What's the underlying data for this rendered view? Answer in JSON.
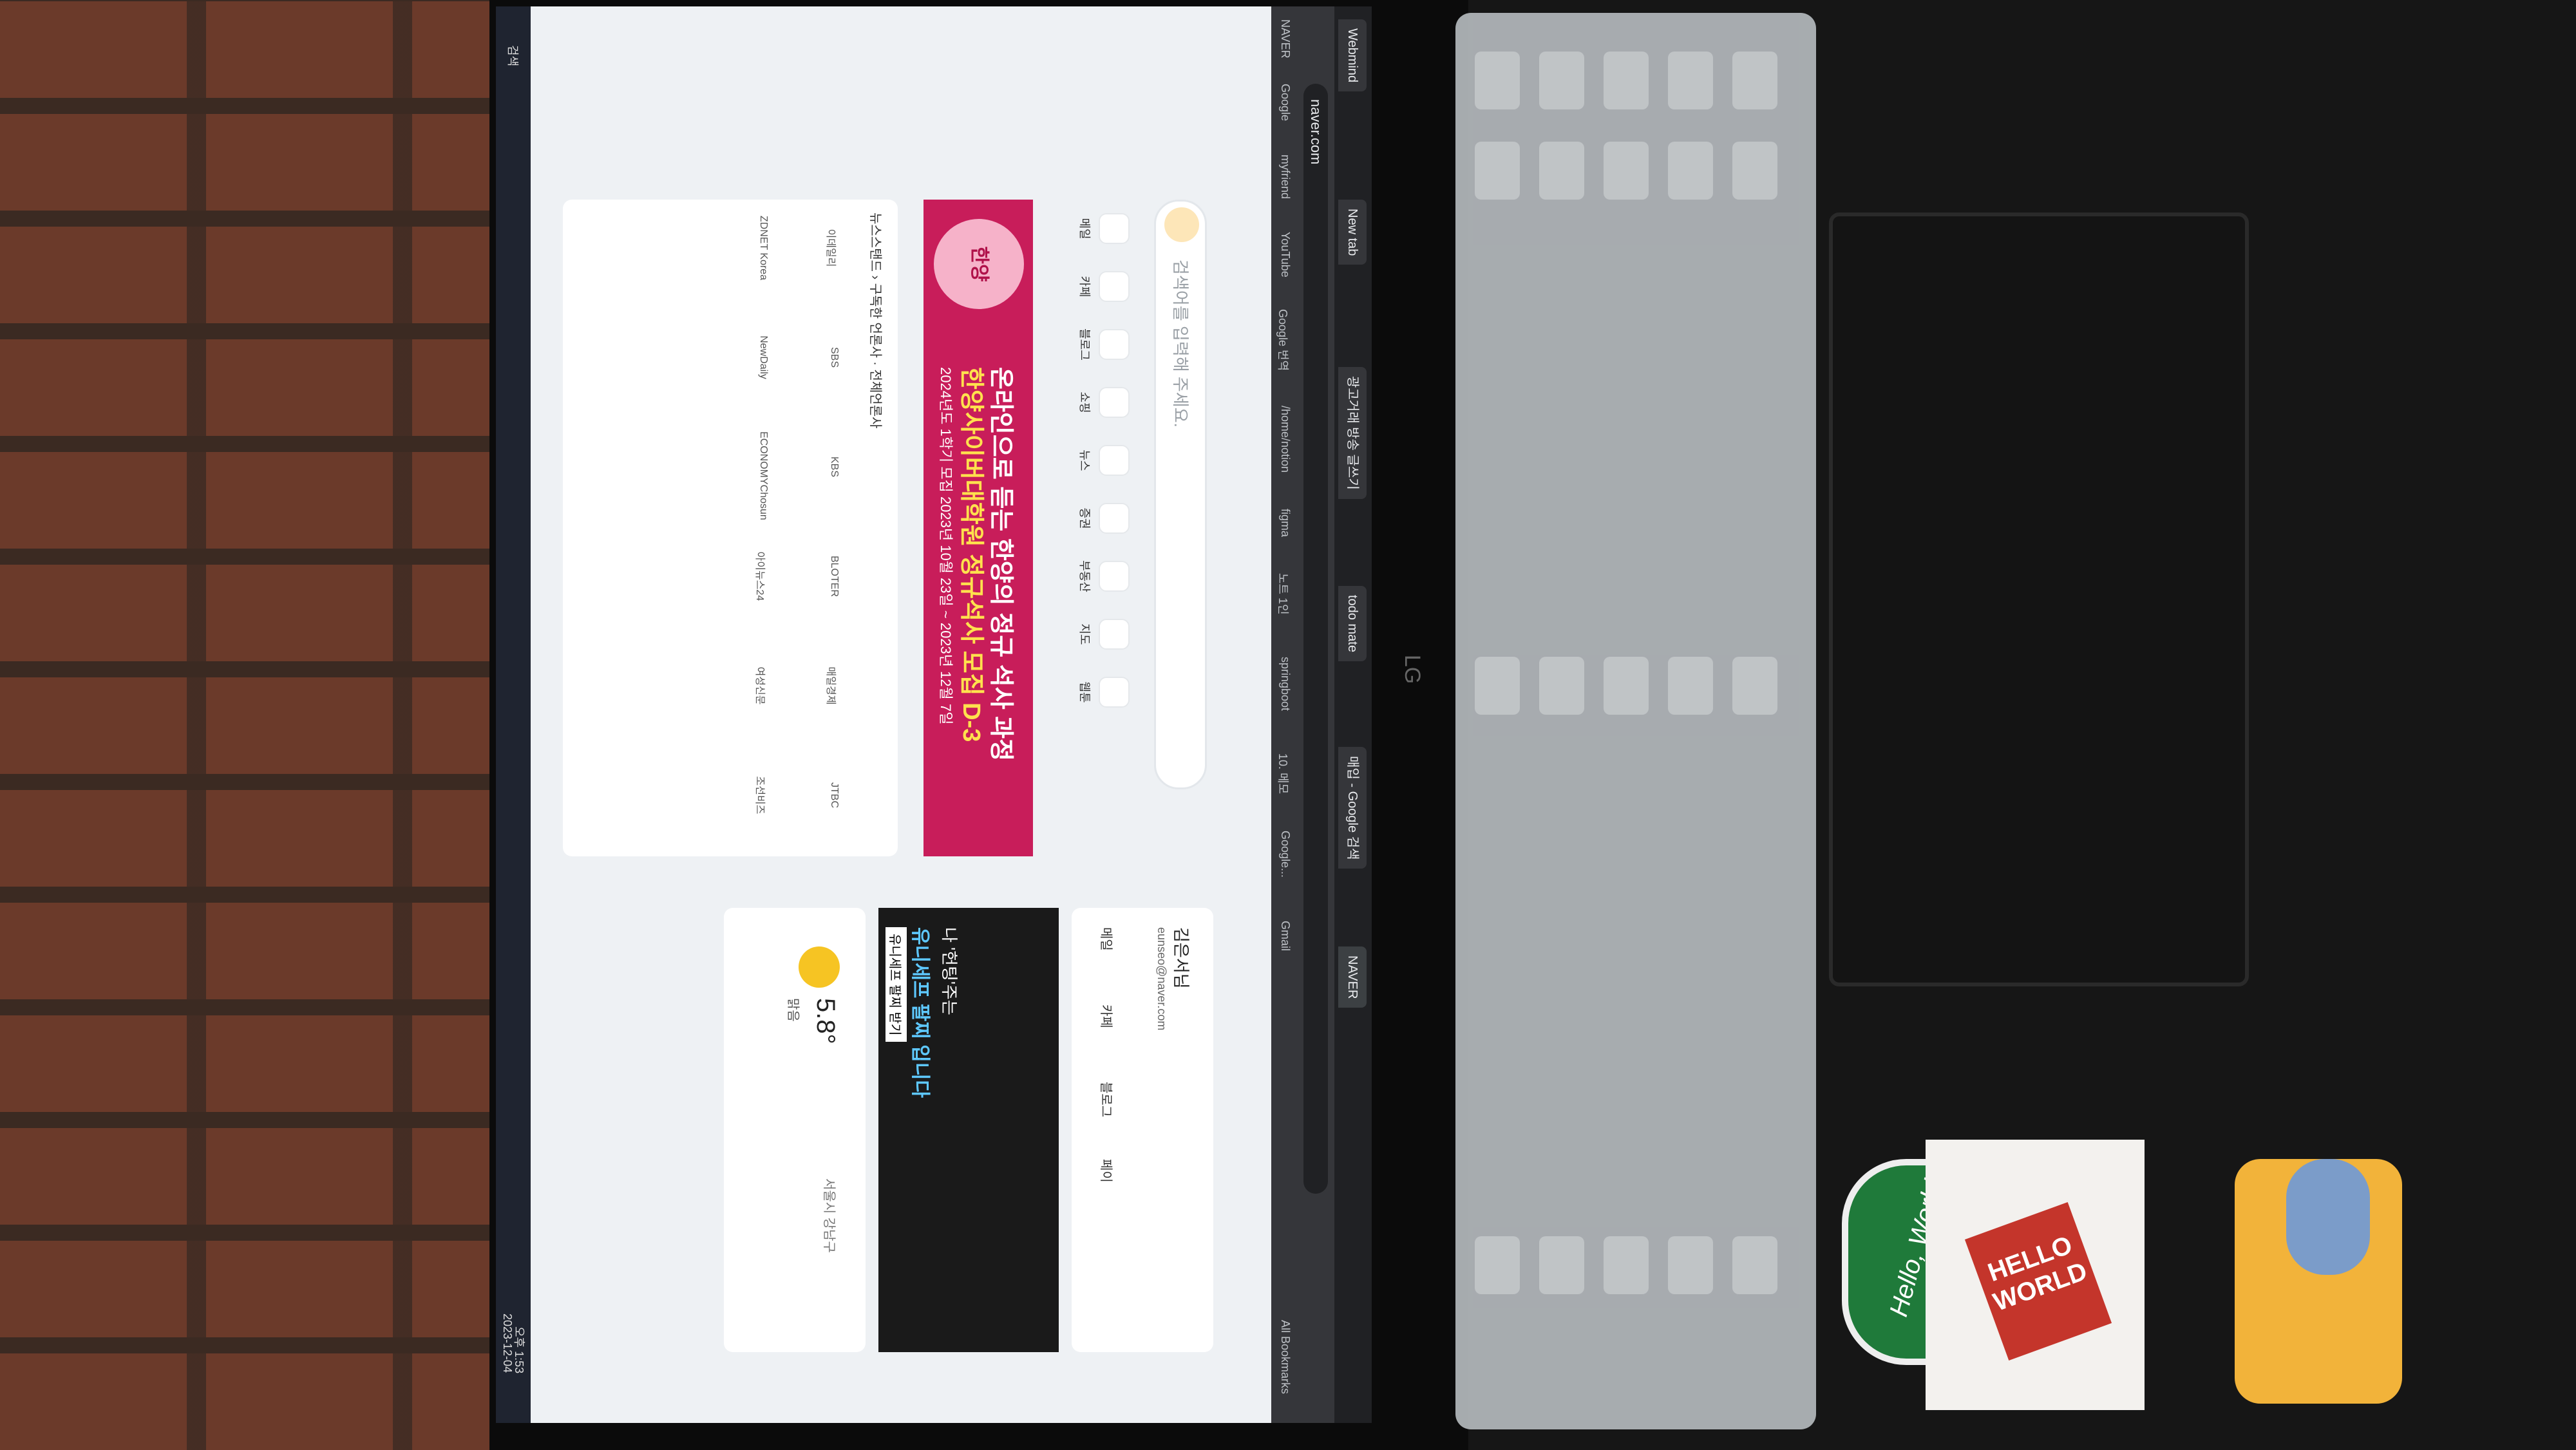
{
  "browser": {
    "tabs": [
      "Webmind",
      "New tab",
      "광고거래 방송 글쓰기",
      "todo mate",
      "매입 - Google 검색",
      "NAVER"
    ],
    "url": "naver.com",
    "bookmarks": [
      "NAVER",
      "Google",
      "myfriend",
      "YouTube",
      "Google 번역",
      "/home/notion",
      "figma",
      "노트 1인",
      "springboot",
      "10. 메모",
      "Google...",
      "Gmail",
      "All Bookmarks"
    ]
  },
  "naver": {
    "search_placeholder": "검색어를 입력해 주세요.",
    "shortcuts": [
      "메일",
      "카페",
      "블로그",
      "쇼핑",
      "뉴스",
      "증권",
      "부동산",
      "지도",
      "웹툰"
    ],
    "banner": {
      "seal": "한양",
      "headline": "온라인으로 듣는 한양의 정규 석사 과정",
      "subline": "한양사이버대학원 정규석사 모집 D-3",
      "dates": "2024년도 1학기 모집 2023년 10월 23일 ~ 2023년 12월 7일"
    },
    "newsstand": {
      "header": "뉴스스탠드 › 구독한 언론사 · 전체언론사",
      "press": [
        "이데일리",
        "SBS",
        "KBS",
        "BLOTER",
        "매일경제",
        "JTBC",
        "ZDNET Korea",
        "NewDaily",
        "ECONOMYChosun",
        "아이뉴스24",
        "여성신문",
        "조선비즈"
      ]
    },
    "profile": {
      "name": "김은서님",
      "email": "eunseo@naver.com",
      "links": [
        "메일",
        "카페",
        "블로그",
        "페이"
      ]
    },
    "ad": {
      "line1": "나 '헌팅'주는",
      "line2": "유니세프 팔찌 입니다",
      "cta": "유니세프 팔찌 받기"
    },
    "weather": {
      "temp": "5.8°",
      "desc": "맑음",
      "location": "서울시 강남구"
    }
  },
  "taskbar": {
    "search": "검색",
    "time": "오후 1:53",
    "date": "2023-12-04"
  },
  "laptop": {
    "brand": "LG",
    "sticker_text": "Hello, World!",
    "sticker_hello": "HELLO WORLD"
  }
}
